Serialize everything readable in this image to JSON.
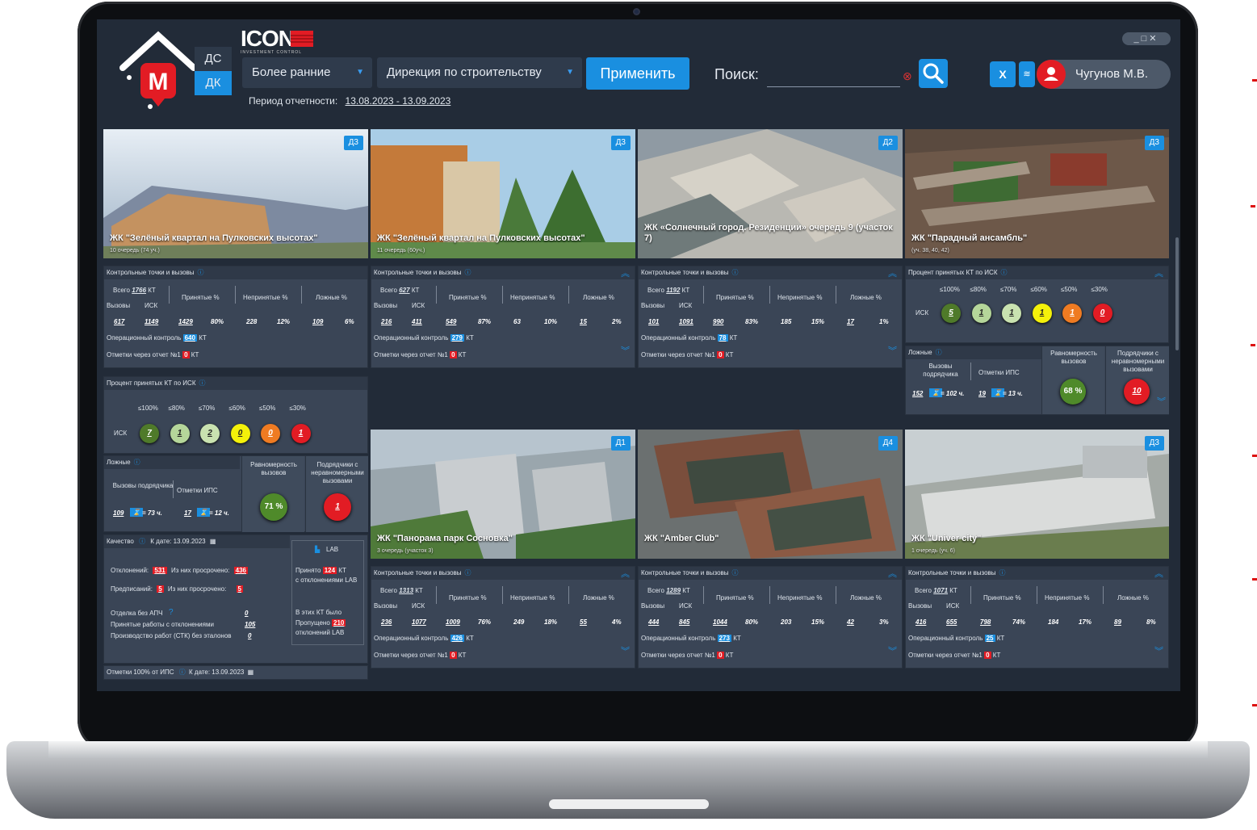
{
  "header": {
    "logo_letter": "M",
    "ds_label": "ДС",
    "dk_label": "ДК",
    "brand": "ICONA",
    "brand_sub": "INVESTMENT CONTROL",
    "period_select": "Более ранние",
    "directorate_select": "Дирекция по строительству",
    "apply_label": "Применить",
    "search_label": "Поиск:",
    "search_value": "",
    "excel_label": "X",
    "user_name": "Чугунов М.В.",
    "window_controls": "_□✕",
    "period_label": "Период отчетности:",
    "period_value": "13.08.2023 - 13.09.2023"
  },
  "labels": {
    "kt_calls": "Контрольные точки и вызовы",
    "total": "Всего",
    "kt": "КТ",
    "calls": "Вызовы",
    "isk": "ИСК",
    "accepted": "Принятые %",
    "rejected": "Непринятые %",
    "false": "Ложные %",
    "op_control": "Операционный контроль",
    "report_marks": "Отметки через отчет №1",
    "pct_accepted": "Процент принятых КТ по ИСК",
    "thresholds": [
      "≤100%",
      "≤80%",
      "≤70%",
      "≤60%",
      "≤50%",
      "≤30%"
    ],
    "lozhnye": "Ложные",
    "calls_contractor": "Вызовы подрядчика",
    "ips_marks": "Отметки ИПС",
    "uniformity": "Равномерность вызовов",
    "uneven_contractors": "Подрядчики с неравномерными вызовами",
    "quality": "Качество",
    "as_of": "К дате: 13.09.2023",
    "deviations": "Отклонений:",
    "of_them_overdue": "Из них просрочено:",
    "prescriptions": "Предписаний:",
    "finishing_no_apch": "Отделка без АПЧ",
    "accepted_with_deviations": "Принятые работы с отклонениями",
    "production_no_standards": "Производство работ (СТК) без эталонов",
    "lab": "LAB",
    "accepted_word": "Принято",
    "with_lab_deviations": "с отклонениями LAB",
    "in_these_kt": "В этих КТ было",
    "skipped": "Пропущено",
    "lab_deviations": "отклонений LAB",
    "ips_100": "Отметки 100% от ИПС"
  },
  "cards": [
    {
      "title": "ЖК \"Зелёный квартал на Пулковских высотах\"",
      "sub": "10 очередь (74 уч.)",
      "badge": "Д3"
    },
    {
      "title": "ЖК \"Зелёный квартал на Пулковских высотах\"",
      "sub": "11 очередь (60уч.)",
      "badge": "Д3"
    },
    {
      "title": "ЖК «Солнечный город. Резиденции» очередь 9 (участок 7)",
      "sub": "",
      "badge": "Д2"
    },
    {
      "title": "ЖК \"Парадный ансамбль\"",
      "sub": "(уч. 38, 40, 42)",
      "badge": "Д3"
    },
    {
      "title": "ЖК \"Панорама парк Сосновка\"",
      "sub": "3 очередь (участок 3)",
      "badge": "Д1"
    },
    {
      "title": "ЖК \"Amber Club\"",
      "sub": "",
      "badge": "Д4"
    },
    {
      "title": "ЖК \"Univer city\"",
      "sub": "1 очередь (уч. 6)",
      "badge": "Д3"
    }
  ],
  "stats": [
    {
      "total": "1766",
      "calls": "617",
      "isk": "1149",
      "acc": "1429",
      "acc_pct": "80%",
      "rej": "228",
      "rej_pct": "12%",
      "fal": "109",
      "fal_pct": "6%",
      "op": "640",
      "rep": "0"
    },
    {
      "total": "627",
      "calls": "216",
      "isk": "411",
      "acc": "549",
      "acc_pct": "87%",
      "rej": "63",
      "rej_pct": "10%",
      "fal": "15",
      "fal_pct": "2%",
      "op": "279",
      "rep": "0"
    },
    {
      "total": "1192",
      "calls": "101",
      "isk": "1091",
      "acc": "990",
      "acc_pct": "83%",
      "rej": "185",
      "rej_pct": "15%",
      "fal": "17",
      "fal_pct": "1%",
      "op": "78",
      "rep": "0"
    },
    {
      "total": "1313",
      "calls": "236",
      "isk": "1077",
      "acc": "1009",
      "acc_pct": "76%",
      "rej": "249",
      "rej_pct": "18%",
      "fal": "55",
      "fal_pct": "4%",
      "op": "426",
      "rep": "0"
    },
    {
      "total": "1289",
      "calls": "444",
      "isk": "845",
      "acc": "1044",
      "acc_pct": "80%",
      "rej": "203",
      "rej_pct": "15%",
      "fal": "42",
      "fal_pct": "3%",
      "op": "273",
      "rep": "0"
    },
    {
      "total": "1071",
      "calls": "416",
      "isk": "655",
      "acc": "798",
      "acc_pct": "74%",
      "rej": "184",
      "rej_pct": "17%",
      "fal": "89",
      "fal_pct": "8%",
      "op": "25",
      "rep": "0"
    }
  ],
  "isk_circles_1": [
    "7",
    "1",
    "2",
    "0",
    "0",
    "1"
  ],
  "isk_circles_4": [
    "5",
    "1",
    "1",
    "1",
    "1",
    "0"
  ],
  "circle_colors": [
    "#4f7a2a",
    "#b5d69a",
    "#c9e2b0",
    "#f4f10a",
    "#ef7b22",
    "#e21c24"
  ],
  "lozh_1": {
    "calls": "109",
    "calls_val": "= 73 ч.",
    "ips": "17",
    "ips_val": "= 12 ч.",
    "uniformity": "71 %",
    "uneven": "1"
  },
  "lozh_4": {
    "calls": "152",
    "calls_val": "= 102 ч.",
    "ips": "19",
    "ips_val": "= 13 ч.",
    "uniformity": "68 %",
    "uneven": "10"
  },
  "quality": {
    "deviations": "531",
    "dev_overdue": "436",
    "prescriptions": "5",
    "presc_overdue": "5",
    "finishing": "0",
    "acc_dev": "105",
    "prod": "0",
    "lab_accepted": "124",
    "lab_skipped": "210"
  },
  "colors": {
    "accent": "#1a8fe0",
    "bg": "#222b38",
    "panel": "#3a4556",
    "red": "#e21c24"
  }
}
